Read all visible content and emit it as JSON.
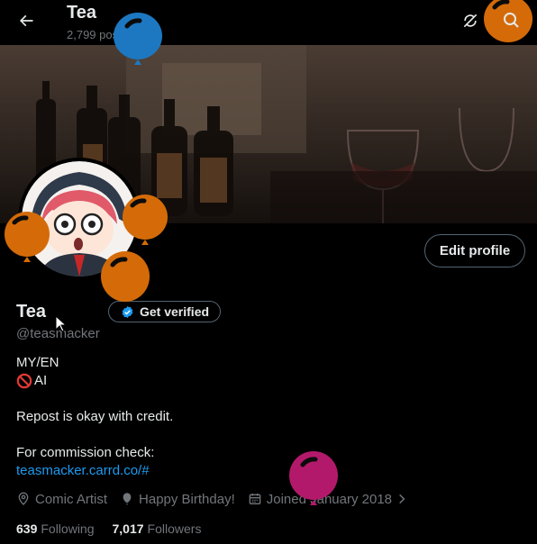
{
  "header": {
    "title": "Tea",
    "posts_count": "2,799 posts"
  },
  "profile": {
    "edit_label": "Edit profile",
    "name": "Tea",
    "verify_label": "Get verified",
    "handle": "@teasmacker",
    "bio": {
      "line1": "MY/EN",
      "line2": "AI",
      "line3": "Repost is okay with credit.",
      "line4": "For commission check:",
      "link": "teasmacker.carrd.co/#"
    },
    "meta": {
      "profession": "Comic Artist",
      "birthday": "Happy Birthday!",
      "joined": "Joined January 2018"
    },
    "following_count": "639",
    "following_label": "Following",
    "followers_count": "7,017",
    "followers_label": "Followers"
  },
  "colors": {
    "background": "#000000",
    "text_primary": "#e7e9ea",
    "text_secondary": "#71767b",
    "link": "#1d9bf0",
    "border": "#536471",
    "balloon_blue": "#1d78c1",
    "balloon_orange": "#d46b08",
    "balloon_pink": "#b3196b"
  },
  "icons": [
    "back-arrow-icon",
    "sync-icon",
    "search-icon",
    "verified-badge-icon",
    "no-entry-icon",
    "location-icon",
    "balloon-icon",
    "calendar-icon",
    "chevron-right-icon"
  ]
}
